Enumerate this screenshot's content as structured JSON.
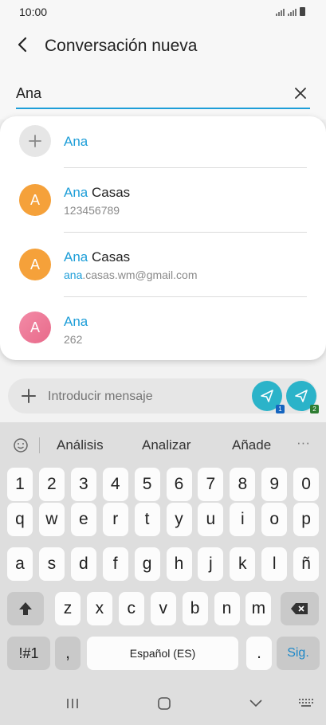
{
  "status": {
    "time": "10:00"
  },
  "header": {
    "title": "Conversación nueva"
  },
  "search": {
    "value": "Ana"
  },
  "results": [
    {
      "highlight": "Ana",
      "rest": "",
      "sub_highlight": "",
      "sub_rest": "",
      "avatar_letter": "",
      "avatar_color": "#e6e6e6"
    },
    {
      "highlight": "Ana",
      "rest": " Casas",
      "sub_highlight": "",
      "sub_rest": "123456789",
      "avatar_letter": "A",
      "avatar_color": "#f5a13a"
    },
    {
      "highlight": "Ana",
      "rest": " Casas",
      "sub_highlight": "ana",
      "sub_rest": ".casas.wm@gmail.com",
      "avatar_letter": "A",
      "avatar_color": "#f5a13a"
    },
    {
      "highlight": "Ana",
      "rest": "",
      "sub_highlight": "",
      "sub_rest": "262",
      "avatar_letter": "A",
      "avatar_color": "#ee7c99"
    }
  ],
  "message_bar": {
    "placeholder": "Introducir mensaje",
    "sim1": "1",
    "sim2": "2"
  },
  "keyboard": {
    "suggestions": [
      "Análisis",
      "Analizar",
      "Añade"
    ],
    "more": "···",
    "row_numbers": [
      "1",
      "2",
      "3",
      "4",
      "5",
      "6",
      "7",
      "8",
      "9",
      "0"
    ],
    "row1": [
      "q",
      "w",
      "e",
      "r",
      "t",
      "y",
      "u",
      "i",
      "o",
      "p"
    ],
    "row2": [
      "a",
      "s",
      "d",
      "f",
      "g",
      "h",
      "j",
      "k",
      "l",
      "ñ"
    ],
    "row3": [
      "z",
      "x",
      "c",
      "v",
      "b",
      "n",
      "m"
    ],
    "symbols": "!#1",
    "comma": ",",
    "space": "Español (ES)",
    "period": ".",
    "next": "Sig."
  },
  "colors": {
    "accent": "#1e9ed8",
    "send": "#2bb3c9"
  }
}
